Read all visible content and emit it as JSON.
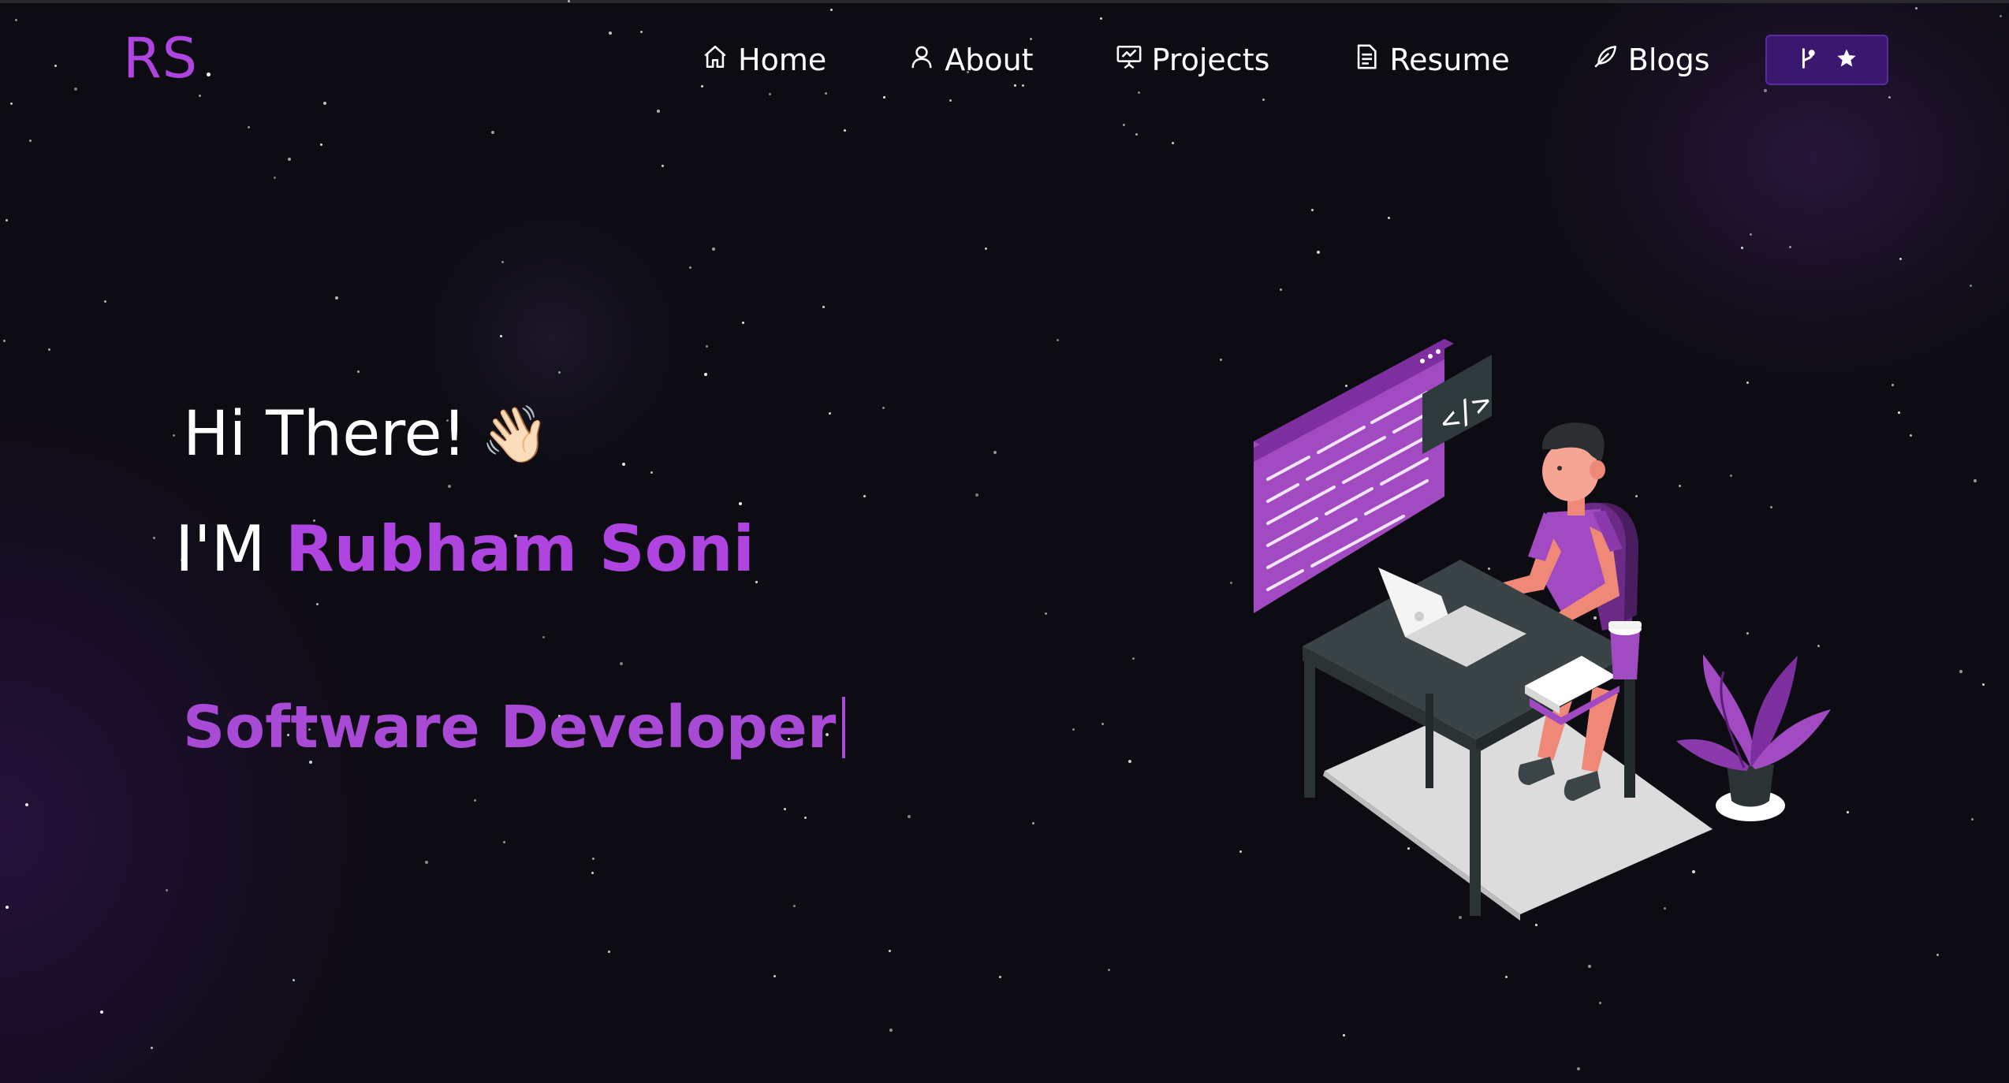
{
  "brand": {
    "logo_text": "RS"
  },
  "nav": {
    "items": [
      {
        "label": "Home",
        "icon": "home-icon"
      },
      {
        "label": "About",
        "icon": "user-icon"
      },
      {
        "label": "Projects",
        "icon": "presentation-icon"
      },
      {
        "label": "Resume",
        "icon": "document-icon"
      },
      {
        "label": "Blogs",
        "icon": "feather-pen-icon"
      }
    ],
    "repo_button": {
      "icons": [
        "git-fork-icon",
        "star-icon"
      ]
    }
  },
  "hero": {
    "greeting": "Hi There!",
    "wave": "👋🏻",
    "name_prefix": "I'M",
    "name": "Rubham Soni",
    "role": "Software Developer",
    "illustration": "developer-at-desk-illustration"
  },
  "colors": {
    "background": "#0d0c12",
    "accent": "#b044e0",
    "accent_dim": "#a84ad6",
    "button_bg": "#3a1870",
    "text": "#ffffff"
  }
}
